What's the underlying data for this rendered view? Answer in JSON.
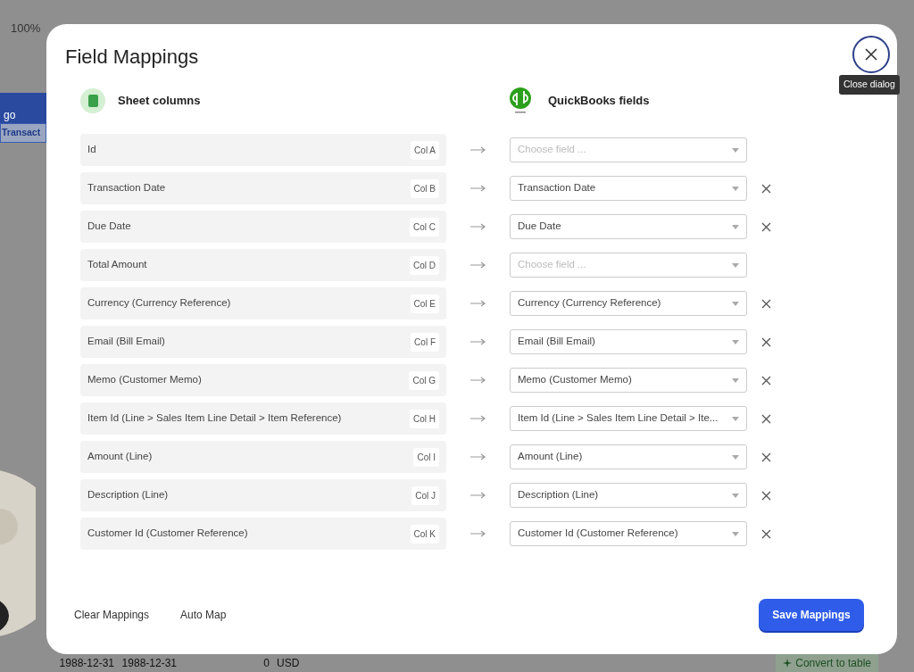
{
  "spreadsheet": {
    "zoom": "100%",
    "cells": [
      "go",
      "Transact"
    ],
    "bottom_row": [
      "1988-12-31",
      "1988-12-31",
      "0",
      "USD"
    ],
    "convert_button": "Convert to table"
  },
  "dialog": {
    "title": "Field Mappings",
    "close_tooltip": "Close dialog",
    "left_header": "Sheet columns",
    "right_header": "QuickBooks fields",
    "rows": [
      {
        "column": "Id",
        "col": "Col A",
        "placeholder": "Choose field ..."
      },
      {
        "column": "Transaction Date",
        "col": "Col B",
        "value": "Transaction Date"
      },
      {
        "column": "Due Date",
        "col": "Col C",
        "value": "Due Date"
      },
      {
        "column": "Total Amount",
        "col": "Col D",
        "placeholder": "Choose field ..."
      },
      {
        "column": "Currency (Currency Reference)",
        "col": "Col E",
        "value": "Currency (Currency Reference)"
      },
      {
        "column": "Email (Bill Email)",
        "col": "Col F",
        "value": "Email (Bill Email)"
      },
      {
        "column": "Memo (Customer Memo)",
        "col": "Col G",
        "value": "Memo (Customer Memo)"
      },
      {
        "column": "Item Id (Line > Sales Item Line Detail > Item Reference)",
        "col": "Col H",
        "value": "Item Id (Line > Sales Item Line Detail > Ite..."
      },
      {
        "column": "Amount (Line)",
        "col": "Col I",
        "value": "Amount (Line)"
      },
      {
        "column": "Description (Line)",
        "col": "Col J",
        "value": "Description (Line)"
      },
      {
        "column": "Customer Id (Customer Reference)",
        "col": "Col K",
        "value": "Customer Id (Customer Reference)"
      }
    ],
    "footer_links": [
      "Clear Mappings",
      "Auto Map"
    ],
    "save_button": "Save Mappings"
  }
}
